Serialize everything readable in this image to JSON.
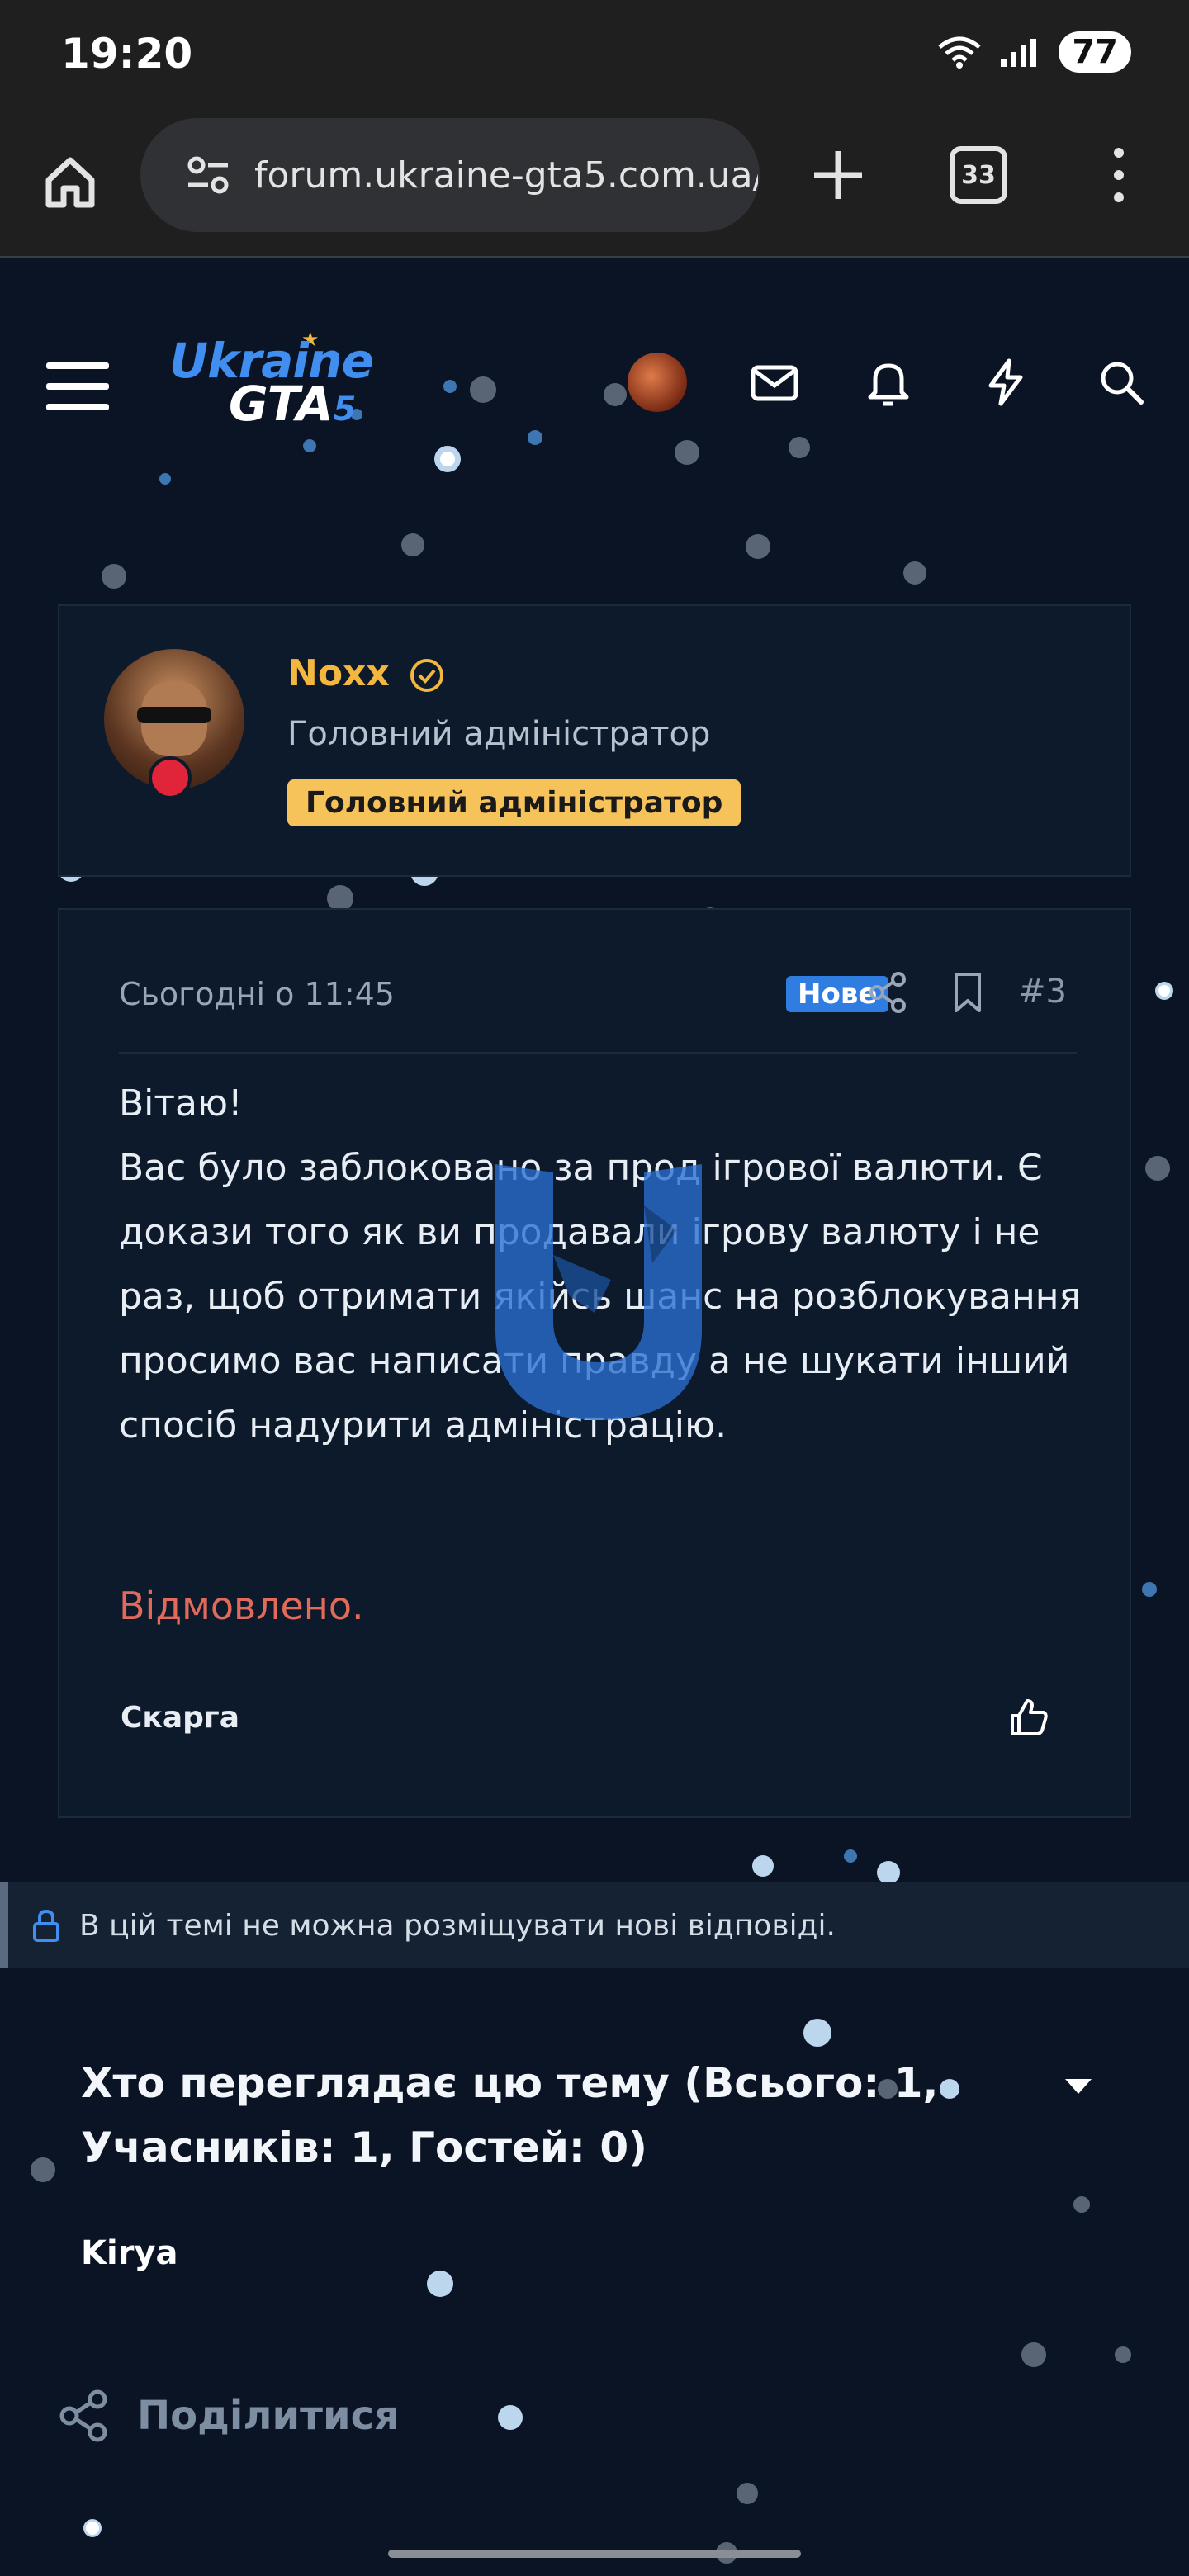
{
  "status_bar": {
    "time": "19:20",
    "battery": "77"
  },
  "browser": {
    "url": "forum.ukraine-gta5.com.ua/th",
    "tab_count": "33"
  },
  "site": {
    "logo_line1": "Ukraine",
    "logo_line2": "GTA",
    "logo_line2_num": "5"
  },
  "author": {
    "name": "Noxx",
    "title": "Головний адміністратор",
    "role_badge": "Головний адміністратор"
  },
  "post": {
    "date": "Сьогодні о 11:45",
    "new_badge": "Нове",
    "number": "#3",
    "greeting": "Вітаю!",
    "body": "Вас було заблоковано за прод ігрової валюти. Є докази того як ви продавали ігрову валюту і не раз, щоб отримати якійсь шанс на розблокування просимо вас написати правду а не шукати інший спосіб надурити адміністрацію.",
    "verdict": "Відмовлено.",
    "report_label": "Скарга"
  },
  "locked_notice": "В цій темі не можна розміщувати нові відповіді.",
  "viewers": {
    "title": "Хто переглядає цю тему (Всього: 1, Учасників: 1, Гостей: 0)",
    "names": [
      "Kirya"
    ]
  },
  "share_label": "Поділитися",
  "colors": {
    "background": "#0a1424",
    "card": "#0d1a2c",
    "username": "#f3b63f",
    "role_badge": "#f6c35a",
    "new_badge": "#2f7de1",
    "denied": "#e26a5a",
    "accent": "#3f8ef0"
  }
}
